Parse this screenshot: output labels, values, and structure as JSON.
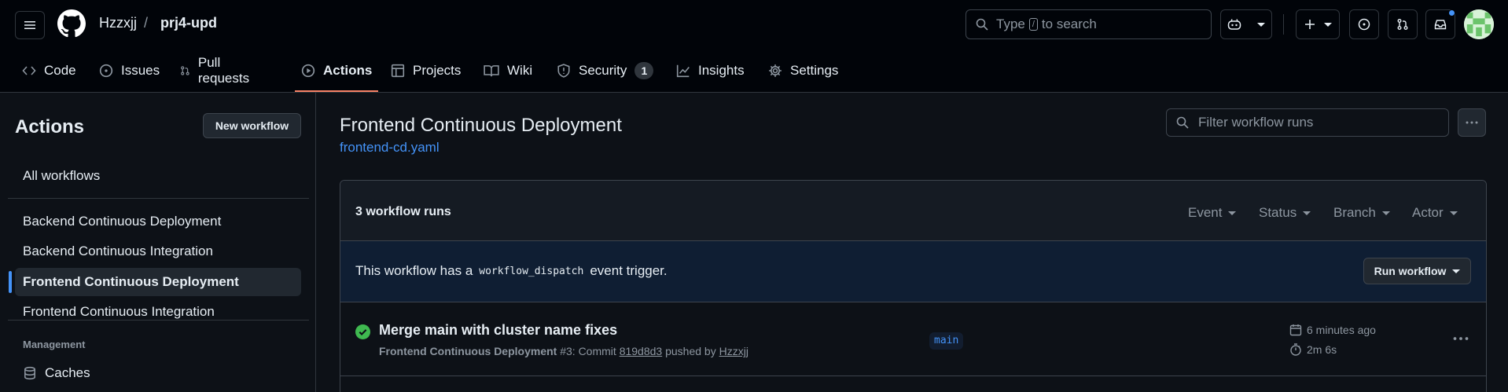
{
  "header": {
    "owner": "Hzzxjj",
    "separator": "/",
    "repo": "prj4-upd",
    "search_prefix": "Type",
    "search_key": "/",
    "search_suffix": "to search"
  },
  "tabs": [
    {
      "label": "Code",
      "icon": "code-icon"
    },
    {
      "label": "Issues",
      "icon": "issue-icon"
    },
    {
      "label": "Pull requests",
      "icon": "pull-request-icon"
    },
    {
      "label": "Actions",
      "icon": "play-icon",
      "active": true
    },
    {
      "label": "Projects",
      "icon": "table-icon"
    },
    {
      "label": "Wiki",
      "icon": "book-icon"
    },
    {
      "label": "Security",
      "icon": "shield-icon",
      "count": "1"
    },
    {
      "label": "Insights",
      "icon": "graph-icon"
    },
    {
      "label": "Settings",
      "icon": "gear-icon"
    }
  ],
  "sidebar": {
    "title": "Actions",
    "new_workflow": "New workflow",
    "all_workflows": "All workflows",
    "workflows": [
      "Backend Continuous Deployment",
      "Backend Continuous Integration",
      "Frontend Continuous Deployment",
      "Frontend Continuous Integration"
    ],
    "selected_workflow": "Frontend Continuous Deployment",
    "management_label": "Management",
    "caches": "Caches"
  },
  "main": {
    "title": "Frontend Continuous Deployment",
    "file": "frontend-cd.yaml",
    "filter_placeholder": "Filter workflow runs",
    "run_count": "3 workflow runs",
    "filters": [
      "Event",
      "Status",
      "Branch",
      "Actor"
    ],
    "banner_prefix": "This workflow has a",
    "banner_code": "workflow_dispatch",
    "banner_suffix": "event trigger.",
    "run_button": "Run workflow"
  },
  "runs": [
    {
      "title": "Merge main with cluster name fixes",
      "workflow": "Frontend Continuous Deployment",
      "number": "#3: Commit",
      "commit": "819d8d3",
      "pushed_by": "pushed by",
      "user": "Hzzxjj",
      "branch": "main",
      "time": "6 minutes ago",
      "duration": "2m 6s",
      "status": "success"
    }
  ],
  "colors": {
    "accent": "#4493f8",
    "tab_underline": "#f78166",
    "success": "#3fb950",
    "background": "#0d1117"
  }
}
